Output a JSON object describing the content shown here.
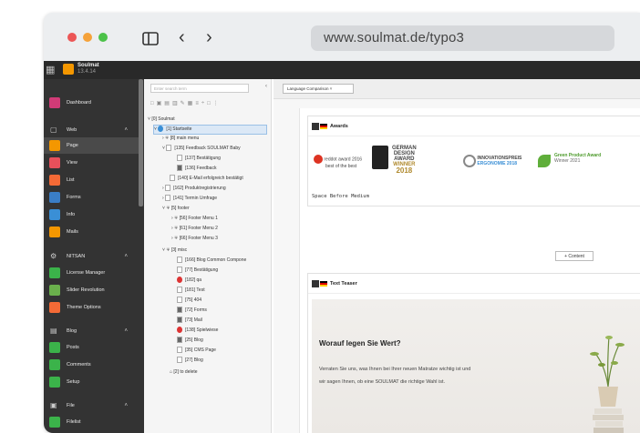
{
  "browser": {
    "url": "www.soulmat.de/typo3"
  },
  "topbar": {
    "brand": "Soulmat",
    "version": "13.4.14"
  },
  "module_menu": {
    "dashboard": "Dashboard",
    "web": {
      "label": "Web",
      "items": [
        "Page",
        "View",
        "List",
        "Forms",
        "Info",
        "Mails"
      ]
    },
    "nitsan": {
      "label": "NITSAN",
      "items": [
        "License Manager",
        "Slider Revolution",
        "Theme Options"
      ]
    },
    "blog": {
      "label": "Blog",
      "items": [
        "Posts",
        "Comments",
        "Setup"
      ]
    },
    "file": {
      "label": "File",
      "items": [
        "Filelist"
      ]
    }
  },
  "page_tree": {
    "search_placeholder": "Enter search term",
    "nodes": [
      "[0] Soulmat",
      "[1] Startseite",
      "[8] main menu",
      "[135] Feedback SOULMAT Baby",
      "[137] Bestätigung",
      "[136] Feedback",
      "[140] E-Mail erfolgreich bestätigt",
      "[162] Produktregistrierung",
      "[141] Termin Umfrage",
      "[5] footer",
      "[56] Footer Menu 1",
      "[61] Footer Menu 2",
      "[66] Footer Menu 3",
      "[3] misc",
      "[166] Blog Common Compone",
      "[77] Bestätigung",
      "[182] qa",
      "[181] Test",
      "[75] 404",
      "[72] Forms",
      "[73] Mail",
      "[138] Spielwiese",
      "[25] Blog",
      "[35] CMS Page",
      "[27] Blog",
      "[2] to delete"
    ]
  },
  "docheader": {
    "language_select": "Language Comparison"
  },
  "awards_element": {
    "title": "Awards",
    "reddot": "reddot award 2016",
    "reddot_sub": "best of the best",
    "gda": [
      "GERMAN",
      "DESIGN",
      "AWARD",
      "WINNER",
      "2018"
    ],
    "innovation": "INNOVATIONSPREIS",
    "innovation_sub": "ERGONOMIE 2018",
    "green": "Green Product Award",
    "green_sub": "Winner 2021",
    "space_label": "Space Before",
    "space_value": "Medium"
  },
  "add_content": "+ Content",
  "teaser_element": {
    "title": "Text Teaser",
    "heading": "Worauf legen Sie Wert?",
    "text_line1": "Verraten Sie uns, was Ihnen bei Ihrer neuen Matratze wichtig ist und",
    "text_line2": "wir sagen Ihnen, ob eine SOULMAT die richtige Wahl ist."
  },
  "colors": {
    "accent": "#f49700",
    "module_bg": "#333333",
    "icon_pink": "#d23b77"
  }
}
